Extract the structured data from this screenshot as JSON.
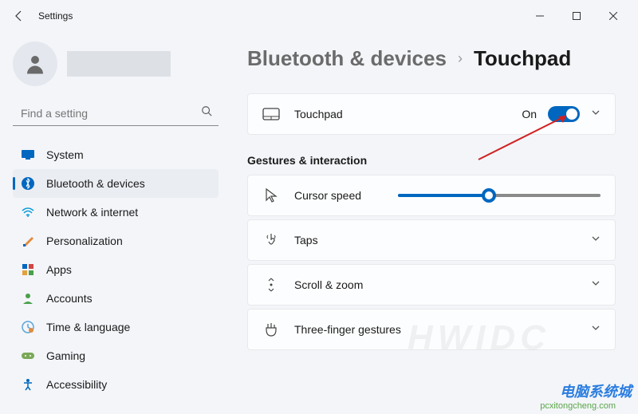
{
  "titlebar": {
    "title": "Settings"
  },
  "search": {
    "placeholder": "Find a setting"
  },
  "nav": {
    "items": [
      {
        "label": "System"
      },
      {
        "label": "Bluetooth & devices"
      },
      {
        "label": "Network & internet"
      },
      {
        "label": "Personalization"
      },
      {
        "label": "Apps"
      },
      {
        "label": "Accounts"
      },
      {
        "label": "Time & language"
      },
      {
        "label": "Gaming"
      },
      {
        "label": "Accessibility"
      }
    ]
  },
  "breadcrumb": {
    "parent": "Bluetooth & devices",
    "current": "Touchpad"
  },
  "touchpad": {
    "label": "Touchpad",
    "state": "On"
  },
  "section": {
    "title": "Gestures & interaction"
  },
  "rows": {
    "cursor": {
      "label": "Cursor speed",
      "value_pct": 45
    },
    "taps": {
      "label": "Taps"
    },
    "scroll": {
      "label": "Scroll & zoom"
    },
    "three": {
      "label": "Three-finger gestures"
    }
  },
  "watermark": {
    "bg": "HWIDC",
    "logo": "电脑系统城",
    "url": "pcxitongcheng.com"
  }
}
